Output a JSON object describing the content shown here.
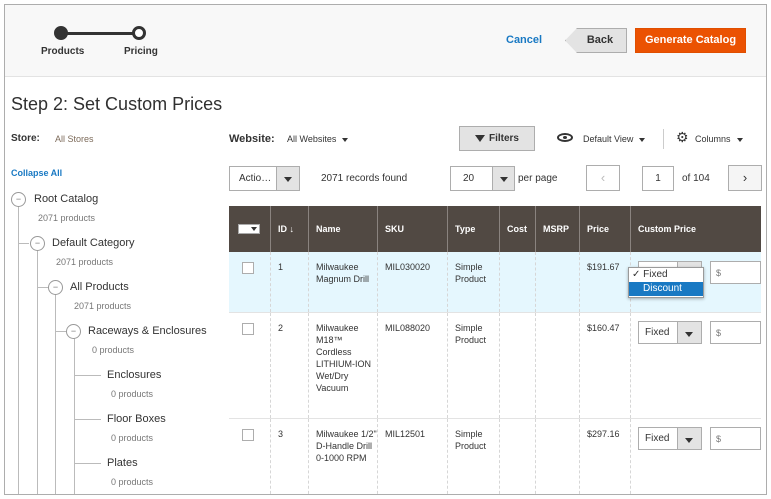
{
  "wizard": {
    "steps": [
      "Products",
      "Pricing"
    ]
  },
  "header_actions": {
    "cancel": "Cancel",
    "back": "Back",
    "generate": "Generate Catalog"
  },
  "page_title": "Step 2: Set Custom Prices",
  "store": {
    "label": "Store:",
    "value": "All Stores"
  },
  "website": {
    "label": "Website:",
    "value": "All Websites"
  },
  "toolbar": {
    "filters": "Filters",
    "view": "Default View",
    "columns": "Columns",
    "actions": "Actio…",
    "records": "2071 records found",
    "per_page_value": "20",
    "per_page_label": "per page",
    "page": "1",
    "of_pages": "of 104"
  },
  "tree": {
    "collapse_all": "Collapse All",
    "nodes": [
      {
        "name": "Root Catalog",
        "count": "2071 products"
      },
      {
        "name": "Default Category",
        "count": "2071 products"
      },
      {
        "name": "All Products",
        "count": "2071 products"
      },
      {
        "name": "Raceways & Enclosures",
        "count": "0 products"
      },
      {
        "name": "Enclosures",
        "count": "0 products"
      },
      {
        "name": "Floor Boxes",
        "count": "0 products"
      },
      {
        "name": "Plates",
        "count": "0 products"
      }
    ]
  },
  "grid": {
    "columns": [
      "ID ↓",
      "Name",
      "SKU",
      "Type",
      "Cost",
      "MSRP",
      "Price",
      "Custom Price"
    ],
    "rows": [
      {
        "id": "1",
        "name": "Milwaukee Magnum Drill",
        "sku": "MIL030020",
        "type": "Simple Product",
        "cost": "",
        "msrp": "",
        "price": "$191.67",
        "custom_type": "Fixed",
        "custom_price": "$"
      },
      {
        "id": "2",
        "name": "Milwaukee M18™ Cordless LITHIUM-ION Wet/Dry Vacuum",
        "sku": "MIL088020",
        "type": "Simple Product",
        "cost": "",
        "msrp": "",
        "price": "$160.47",
        "custom_type": "Fixed",
        "custom_price": "$"
      },
      {
        "id": "3",
        "name": "Milwaukee 1/2\" D-Handle Drill 0-1000 RPM",
        "sku": "MIL12501",
        "type": "Simple Product",
        "cost": "",
        "msrp": "",
        "price": "$297.16",
        "custom_type": "Fixed",
        "custom_price": "$"
      }
    ]
  },
  "dropdown": {
    "options": [
      "✓ Fixed",
      "Discount"
    ]
  }
}
